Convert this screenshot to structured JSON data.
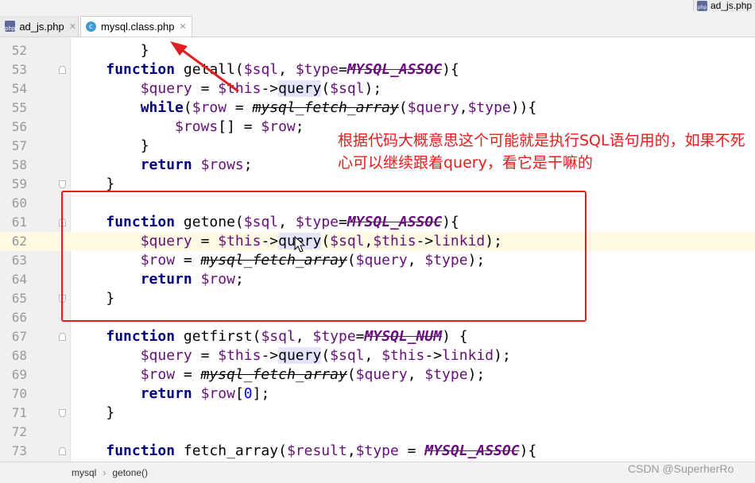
{
  "tabs": [
    {
      "label": "ad_js.php",
      "icon": "php-file-icon"
    },
    {
      "label": "mysql.class.php",
      "icon": "php-class-icon"
    },
    {
      "label": "ad_js.php",
      "icon": "php-file-icon"
    }
  ],
  "editor": {
    "current_line": 62,
    "lines": [
      {
        "n": "52",
        "code": "        }"
      },
      {
        "n": "53",
        "code": "    function getall($sql, $type=MYSQL_ASSOC){"
      },
      {
        "n": "54",
        "code": "        $query = $this->query($sql);"
      },
      {
        "n": "55",
        "code": "        while($row = mysql_fetch_array($query,$type)){"
      },
      {
        "n": "56",
        "code": "            $rows[] = $row;"
      },
      {
        "n": "57",
        "code": "        }"
      },
      {
        "n": "58",
        "code": "        return $rows;"
      },
      {
        "n": "59",
        "code": "    }"
      },
      {
        "n": "60",
        "code": ""
      },
      {
        "n": "61",
        "code": "    function getone($sql, $type=MYSQL_ASSOC){"
      },
      {
        "n": "62",
        "code": "        $query = $this->query($sql,$this->linkid);"
      },
      {
        "n": "63",
        "code": "        $row = mysql_fetch_array($query, $type);"
      },
      {
        "n": "64",
        "code": "        return $row;"
      },
      {
        "n": "65",
        "code": "    }"
      },
      {
        "n": "66",
        "code": ""
      },
      {
        "n": "67",
        "code": "    function getfirst($sql, $type=MYSQL_NUM) {"
      },
      {
        "n": "68",
        "code": "        $query = $this->query($sql, $this->linkid);"
      },
      {
        "n": "69",
        "code": "        $row = mysql_fetch_array($query, $type);"
      },
      {
        "n": "70",
        "code": "        return $row[0];"
      },
      {
        "n": "71",
        "code": "    }"
      },
      {
        "n": "72",
        "code": ""
      },
      {
        "n": "73",
        "code": "    function fetch_array($result,$type = MYSQL_ASSOC){"
      }
    ]
  },
  "annotation": {
    "text": "根据代码大概意思这个可能就是执行SQL语句用的，如果不死心可以继续跟着query，看它是干嘛的",
    "color": "#f01818"
  },
  "breadcrumb": {
    "items": [
      "mysql",
      "getone()"
    ],
    "separator": "›"
  },
  "watermark": "CSDN @SuperherRo",
  "colors": {
    "keyword": "#000080",
    "variable": "#660e7a",
    "number": "#0000ff",
    "annotation": "#e02020",
    "current_line": "#fffae3"
  }
}
